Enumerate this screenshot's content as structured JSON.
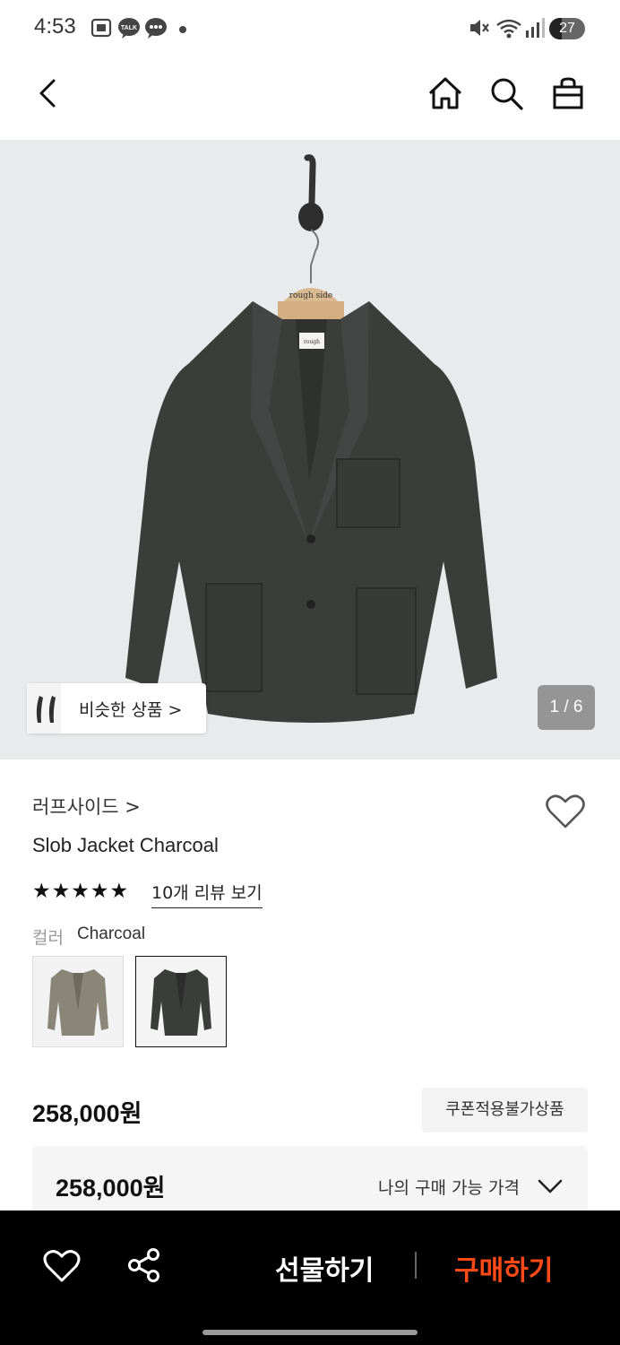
{
  "status_bar": {
    "time": "4:53",
    "battery": "27"
  },
  "gallery": {
    "similar_label": "비슷한 상품 >",
    "counter": "1 / 6"
  },
  "product": {
    "brand": "러프사이드 >",
    "name": "Slob Jacket Charcoal",
    "stars": "★★★★★",
    "review_link": "10개 리뷰 보기",
    "color_label": "컬러",
    "color_value": "Charcoal",
    "price": "258,000원",
    "coupon_badge": "쿠폰적용불가상품",
    "my_price": "258,000원",
    "my_price_label": "나의 구매 가능 가격"
  },
  "bottom_bar": {
    "gift_label": "선물하기",
    "buy_label": "구매하기"
  },
  "colors": {
    "buy_accent": "#ff4a17",
    "hero_bg": "#e9eaec"
  }
}
